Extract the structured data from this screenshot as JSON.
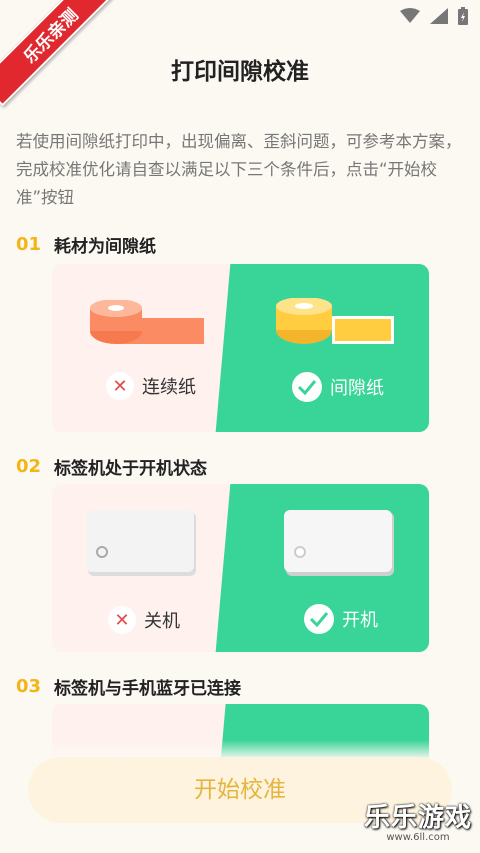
{
  "ribbon": {
    "text": "乐乐亲测"
  },
  "header": {
    "title": "打印间隙校准"
  },
  "intro": "若使用间隙纸打印中，出现偏离、歪斜问题，可参考本方案，完成校准优化请自查以满足以下三个条件后，点击“开始校准”按钮",
  "sections": [
    {
      "num": "01",
      "title": "耗材为间隙纸",
      "bad_label": "连续纸",
      "good_label": "间隙纸"
    },
    {
      "num": "02",
      "title": "标签机处于开机状态",
      "bad_label": "关机",
      "good_label": "开机"
    },
    {
      "num": "03",
      "title": "标签机与手机蓝牙已连接"
    }
  ],
  "button": {
    "label": "开始校准"
  },
  "watermark": {
    "brand": "乐乐游戏",
    "url": "www.6ll.com"
  },
  "colors": {
    "accent": "#39d497",
    "number": "#f3b417",
    "button_text": "#e6b53d",
    "bad_mark": "#e24a4a"
  }
}
